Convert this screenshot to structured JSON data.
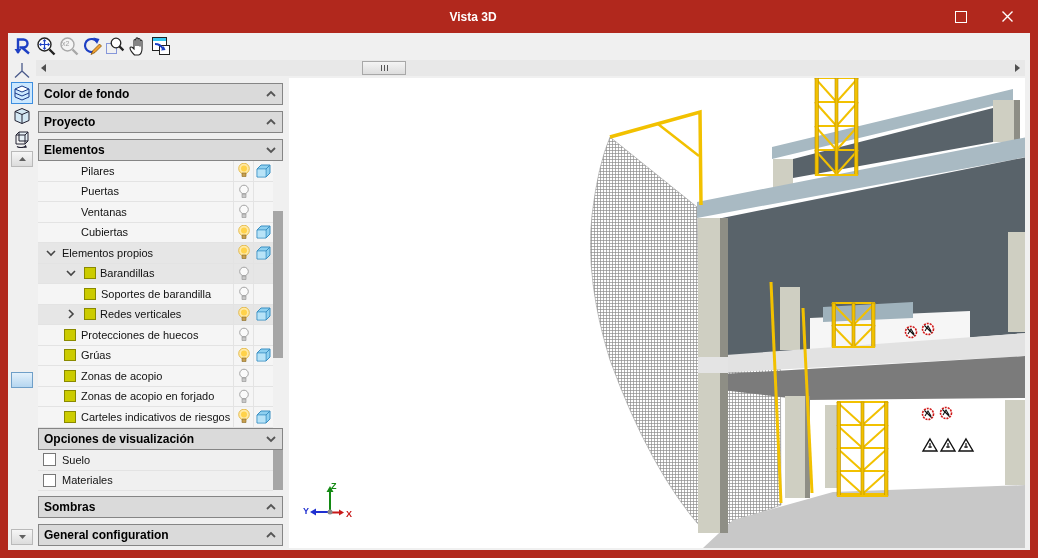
{
  "window": {
    "title": "Vista 3D"
  },
  "tools": [
    {
      "disabled": false
    },
    {
      "disabled": false
    },
    {
      "disabled": true,
      "label": "x2"
    },
    {
      "disabled": false
    },
    {
      "disabled": false
    },
    {
      "disabled": false
    },
    {
      "disabled": false
    }
  ],
  "side_tools": [
    {
      "selected": false
    },
    {
      "selected": true
    },
    {
      "selected": false
    },
    {
      "selected": false
    }
  ],
  "panel": {
    "sections": [
      {
        "title": "Color de fondo",
        "expanded": false
      },
      {
        "title": "Proyecto",
        "expanded": false
      },
      {
        "title": "Elementos",
        "expanded": true,
        "items": [
          {
            "children": [
              {
                "label": "Pilares",
                "lit": true,
                "shown_3d": true
              },
              {
                "label": "Puertas",
                "lit": false,
                "shown_3d": false
              },
              {
                "label": "Ventanas",
                "lit": false,
                "shown_3d": false
              },
              {
                "label": "Cubiertas",
                "lit": true,
                "shown_3d": true
              }
            ]
          },
          {
            "label": "Elementos propios",
            "lit": true,
            "shown_3d": true,
            "expanded": true,
            "children": [
              {
                "label": "Barandillas",
                "color": "#cccc00",
                "lit": false,
                "shown_3d": false,
                "expanded": true,
                "children": [
                  {
                    "label": "Soportes de barandilla",
                    "color": "#cccc00",
                    "lit": false,
                    "shown_3d": false
                  }
                ]
              },
              {
                "label": "Redes verticales",
                "color": "#cccc00",
                "lit": true,
                "shown_3d": true,
                "expanded": false
              },
              {
                "label": "Protecciones de huecos",
                "color": "#cccc00",
                "lit": false,
                "shown_3d": false
              },
              {
                "label": "Grúas",
                "color": "#cccc00",
                "lit": true,
                "shown_3d": true
              },
              {
                "label": "Zonas de acopio",
                "color": "#cccc00",
                "lit": false,
                "shown_3d": false
              },
              {
                "label": "Zonas de acopio en forjado",
                "color": "#cccc00",
                "lit": false,
                "shown_3d": false
              },
              {
                "label": "Carteles indicativos de riesgos",
                "color": "#cccc00",
                "lit": true,
                "shown_3d": true
              }
            ]
          }
        ]
      },
      {
        "title": "Opciones de visualización",
        "expanded": true,
        "options": [
          {
            "label": "Suelo",
            "checked": false
          },
          {
            "label": "Materiales",
            "checked": false
          }
        ]
      },
      {
        "title": "Sombras",
        "expanded": false
      },
      {
        "title": "General configuration",
        "expanded": false
      }
    ]
  },
  "viewport": {
    "axes": [
      {
        "label": "Z",
        "color": "#138a13"
      },
      {
        "label": "Y",
        "color": "#1f2fd0"
      },
      {
        "label": "X",
        "color": "#c81818"
      }
    ]
  }
}
